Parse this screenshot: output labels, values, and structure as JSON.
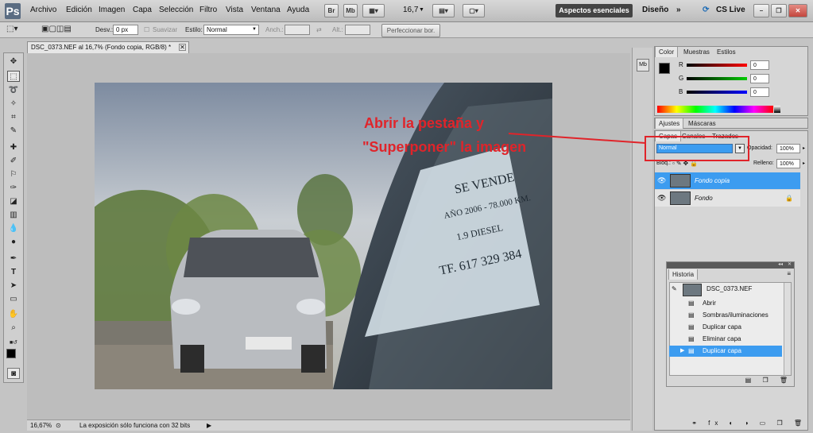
{
  "menubar": {
    "items": [
      "Archivo",
      "Edición",
      "Imagen",
      "Capa",
      "Selección",
      "Filtro",
      "Vista",
      "Ventana",
      "Ayuda"
    ],
    "bridge": "Br",
    "minibridge": "Mb",
    "zoom": "16,7",
    "workspace": "Aspectos esenciales",
    "design": "Diseño",
    "cslive": "CS Live"
  },
  "options": {
    "desv_label": "Desv.:",
    "desv_value": "0 px",
    "suavizar": "Suavizar",
    "estilo_label": "Estilo:",
    "estilo_value": "Normal",
    "anch": "Anch.:",
    "alt": "Alt.:",
    "refine": "Perfeccionar bor."
  },
  "document": {
    "tab_title": "DSC_0373.NEF al 16,7% (Fondo copia, RGB/8) *",
    "status_zoom": "16,67%",
    "status_msg": "La exposición sólo funciona con 32 bits",
    "sign_lines": [
      "SE VENDE",
      "AÑO 2006 - 78.000 KM.",
      "1.9 DIESEL",
      "TF. 617 329 384"
    ]
  },
  "color_panel": {
    "tabs": [
      "Color",
      "Muestras",
      "Estilos"
    ],
    "r_label": "R",
    "r_value": "0",
    "g_label": "G",
    "g_value": "0",
    "b_label": "B",
    "b_value": "0"
  },
  "adjust_panel": {
    "tabs": [
      "Ajustes",
      "Máscaras"
    ]
  },
  "layers_panel": {
    "tabs": [
      "Capas",
      "Canales",
      "Trazados"
    ],
    "blend_mode": "Normal",
    "opacity_label": "Opacidad:",
    "opacity_value": "100%",
    "lock_label": "Bloq.:",
    "fill_label": "Relleno:",
    "fill_value": "100%",
    "layers": [
      "Fondo copia",
      "Fondo"
    ]
  },
  "history_panel": {
    "title": "Historia",
    "snapshot": "DSC_0373.NEF",
    "steps": [
      "Abrir",
      "Sombras/iluminaciones",
      "Duplicar capa",
      "Eliminar capa",
      "Duplicar capa"
    ]
  },
  "annotation": {
    "line1": "Abrir la pestaña y",
    "line2": "\"Superponer\" la imagen",
    "color": "#e0242a"
  },
  "colors": {
    "selected": "#3c9cf0",
    "annotation_red": "#e0242a"
  }
}
